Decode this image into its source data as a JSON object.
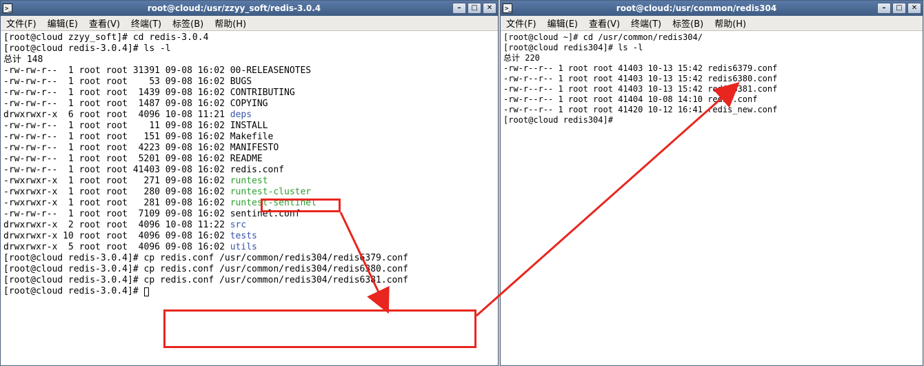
{
  "left": {
    "title": "root@cloud:/usr/zzyy_soft/redis-3.0.4",
    "menu": {
      "file": "文件(F)",
      "edit": "编辑(E)",
      "view": "查看(V)",
      "terminal": "终端(T)",
      "tabs": "标签(B)",
      "help": "帮助(H)"
    },
    "prompt1": "[root@cloud zzyy_soft]# cd redis-3.0.4",
    "prompt2": "[root@cloud redis-3.0.4]# ls -l",
    "total": "总计 148",
    "files": [
      {
        "perm": "-rw-rw-r--",
        "n": "1",
        "own": "root root",
        "size": "31391",
        "date": "09-08 16:02",
        "name": "00-RELEASENOTES",
        "cls": ""
      },
      {
        "perm": "-rw-rw-r--",
        "n": "1",
        "own": "root root",
        "size": "53",
        "date": "09-08 16:02",
        "name": "BUGS",
        "cls": ""
      },
      {
        "perm": "-rw-rw-r--",
        "n": "1",
        "own": "root root",
        "size": "1439",
        "date": "09-08 16:02",
        "name": "CONTRIBUTING",
        "cls": ""
      },
      {
        "perm": "-rw-rw-r--",
        "n": "1",
        "own": "root root",
        "size": "1487",
        "date": "09-08 16:02",
        "name": "COPYING",
        "cls": ""
      },
      {
        "perm": "drwxrwxr-x",
        "n": "6",
        "own": "root root",
        "size": "4096",
        "date": "10-08 11:21",
        "name": "deps",
        "cls": "blue"
      },
      {
        "perm": "-rw-rw-r--",
        "n": "1",
        "own": "root root",
        "size": "11",
        "date": "09-08 16:02",
        "name": "INSTALL",
        "cls": ""
      },
      {
        "perm": "-rw-rw-r--",
        "n": "1",
        "own": "root root",
        "size": "151",
        "date": "09-08 16:02",
        "name": "Makefile",
        "cls": ""
      },
      {
        "perm": "-rw-rw-r--",
        "n": "1",
        "own": "root root",
        "size": "4223",
        "date": "09-08 16:02",
        "name": "MANIFESTO",
        "cls": ""
      },
      {
        "perm": "-rw-rw-r--",
        "n": "1",
        "own": "root root",
        "size": "5201",
        "date": "09-08 16:02",
        "name": "README",
        "cls": ""
      },
      {
        "perm": "-rw-rw-r--",
        "n": "1",
        "own": "root root",
        "size": "41403",
        "date": "09-08 16:02",
        "name": "redis.conf",
        "cls": ""
      },
      {
        "perm": "-rwxrwxr-x",
        "n": "1",
        "own": "root root",
        "size": "271",
        "date": "09-08 16:02",
        "name": "runtest",
        "cls": "green"
      },
      {
        "perm": "-rwxrwxr-x",
        "n": "1",
        "own": "root root",
        "size": "280",
        "date": "09-08 16:02",
        "name": "runtest-cluster",
        "cls": "green"
      },
      {
        "perm": "-rwxrwxr-x",
        "n": "1",
        "own": "root root",
        "size": "281",
        "date": "09-08 16:02",
        "name": "runtest-sentinel",
        "cls": "green"
      },
      {
        "perm": "-rw-rw-r--",
        "n": "1",
        "own": "root root",
        "size": "7109",
        "date": "09-08 16:02",
        "name": "sentinel.conf",
        "cls": ""
      },
      {
        "perm": "drwxrwxr-x",
        "n": "2",
        "own": "root root",
        "size": "4096",
        "date": "10-08 11:22",
        "name": "src",
        "cls": "blue"
      },
      {
        "perm": "drwxrwxr-x",
        "n": "10",
        "own": "root root",
        "size": "4096",
        "date": "09-08 16:02",
        "name": "tests",
        "cls": "blue"
      },
      {
        "perm": "drwxrwxr-x",
        "n": "5",
        "own": "root root",
        "size": "4096",
        "date": "09-08 16:02",
        "name": "utils",
        "cls": "blue"
      }
    ],
    "cp1": "[root@cloud redis-3.0.4]# cp redis.conf /usr/common/redis304/redis6379.conf",
    "cp2": "[root@cloud redis-3.0.4]# cp redis.conf /usr/common/redis304/redis6380.conf",
    "cp3": "[root@cloud redis-3.0.4]# cp redis.conf /usr/common/redis304/redis6381.conf",
    "prompt_empty": "[root@cloud redis-3.0.4]# "
  },
  "right": {
    "title": "root@cloud:/usr/common/redis304",
    "menu": {
      "file": "文件(F)",
      "edit": "编辑(E)",
      "view": "查看(V)",
      "terminal": "终端(T)",
      "tabs": "标签(B)",
      "help": "帮助(H)"
    },
    "prompt1": "[root@cloud ~]# cd /usr/common/redis304/",
    "prompt2": "[root@cloud redis304]# ls -l",
    "total": "总计 220",
    "files": [
      {
        "perm": "-rw-r--r--",
        "n": "1",
        "own": "root root",
        "size": "41403",
        "date": "10-13 15:42",
        "name": "redis6379.conf"
      },
      {
        "perm": "-rw-r--r--",
        "n": "1",
        "own": "root root",
        "size": "41403",
        "date": "10-13 15:42",
        "name": "redis6380.conf"
      },
      {
        "perm": "-rw-r--r--",
        "n": "1",
        "own": "root root",
        "size": "41403",
        "date": "10-13 15:42",
        "name": "redis6381.conf"
      },
      {
        "perm": "-rw-r--r--",
        "n": "1",
        "own": "root root",
        "size": "41404",
        "date": "10-08 14:10",
        "name": "redis.conf"
      },
      {
        "perm": "-rw-r--r--",
        "n": "1",
        "own": "root root",
        "size": "41420",
        "date": "10-12 16:41",
        "name": "redis_new.conf"
      }
    ],
    "prompt_empty": "[root@cloud redis304]# "
  },
  "window_controls": {
    "minimize_glyph": "–",
    "maximize_glyph": "□",
    "close_glyph": "✕"
  }
}
